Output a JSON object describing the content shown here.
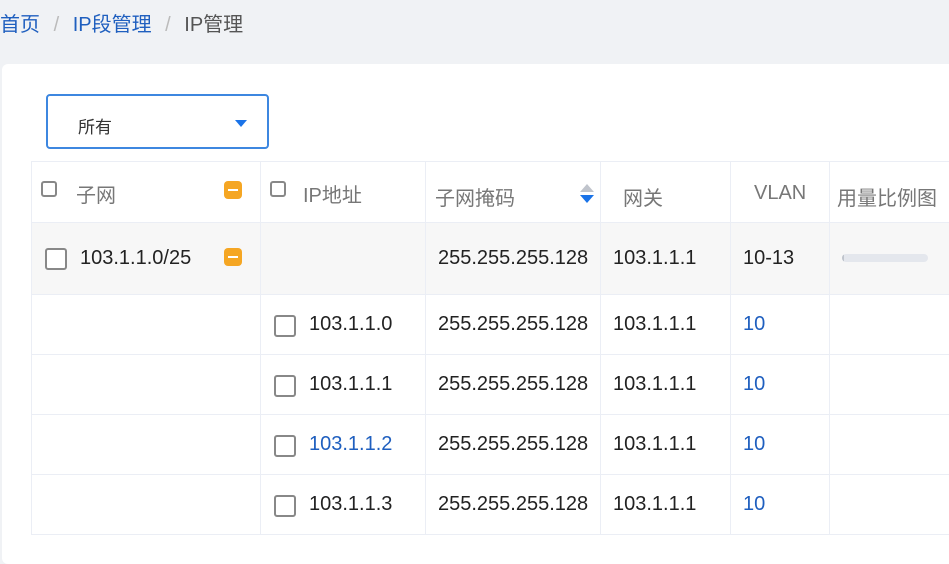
{
  "breadcrumb": {
    "home": "首页",
    "segment": "IP段管理",
    "current": "IP管理",
    "separator": "/"
  },
  "filter": {
    "selected": "所有"
  },
  "table": {
    "headers": {
      "subnet": "子网",
      "ip": "IP地址",
      "mask": "子网掩码",
      "gateway": "网关",
      "vlan": "VLAN",
      "usage": "用量比例图"
    },
    "group": {
      "subnet": "103.1.1.0/25",
      "mask": "255.255.255.128",
      "gateway": "103.1.1.1",
      "vlan": "10-13",
      "usage_fraction": 0.02
    },
    "rows": [
      {
        "ip": "103.1.1.0",
        "mask": "255.255.255.128",
        "gateway": "103.1.1.1",
        "vlan": "10"
      },
      {
        "ip": "103.1.1.1",
        "mask": "255.255.255.128",
        "gateway": "103.1.1.1",
        "vlan": "10"
      },
      {
        "ip": "103.1.1.2",
        "mask": "255.255.255.128",
        "gateway": "103.1.1.1",
        "vlan": "10"
      },
      {
        "ip": "103.1.1.3",
        "mask": "255.255.255.128",
        "gateway": "103.1.1.1",
        "vlan": "10"
      }
    ]
  },
  "colors": {
    "link": "#1f5fbf",
    "accent": "#1a73e8",
    "warning": "#f5a623"
  }
}
